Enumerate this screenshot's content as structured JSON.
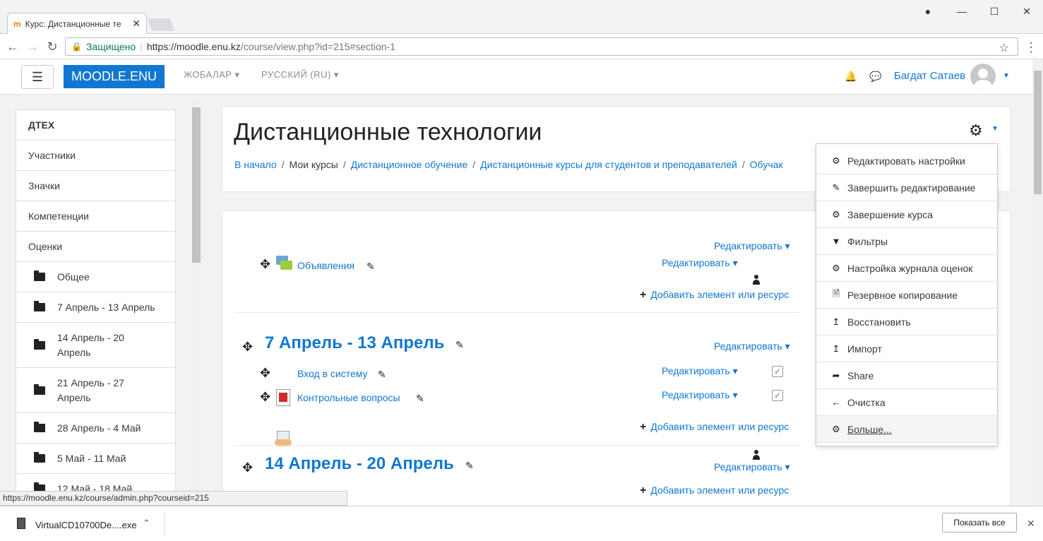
{
  "browser": {
    "tab_title": "Курс: Дистанционные те",
    "tab_close": "✕",
    "window_controls": [
      "—",
      "☐",
      "✕"
    ],
    "secure_label": "Защищено",
    "url_host": "https://moodle.enu.kz",
    "url_path": "/course/view.php?id=215#section-1",
    "status_url": "https://moodle.enu.kz/course/admin.php?courseid=215"
  },
  "navbar": {
    "brand": "MOODLE.ENU",
    "links": [
      "ЖОБАЛАР",
      "РУССКИЙ (RU)"
    ],
    "user_name": "Багдат Сатаев"
  },
  "sidebar": {
    "items": [
      {
        "label": "ДТЕХ"
      },
      {
        "label": "Участники"
      },
      {
        "label": "Значки"
      },
      {
        "label": "Компетенции"
      },
      {
        "label": "Оценки"
      },
      {
        "label": "Общее"
      },
      {
        "label": "7 Апрель - 13 Апрель"
      },
      {
        "label": "14 Апрель - 20 Апрель"
      },
      {
        "label": "21 Апрель - 27 Апрель"
      },
      {
        "label": "28 Апрель - 4 Май"
      },
      {
        "label": "5 Май - 11 Май"
      },
      {
        "label": "12 Май - 18 Май"
      }
    ]
  },
  "header": {
    "title": "Дистанционные технологии",
    "breadcrumb": [
      "В начало",
      "Мои курсы",
      "Дистанционное обучение",
      "Дистанционные курсы для студентов и преподавателей",
      "Обучак"
    ]
  },
  "course": {
    "edit_label": "Редактировать",
    "add_label": "Добавить элемент или ресурс",
    "general": {
      "activities": [
        "Объявления"
      ]
    },
    "sections": [
      {
        "title": "7 Апрель - 13 Апрель",
        "activities": [
          "Вход в систему",
          "Контрольные вопросы"
        ]
      },
      {
        "title": "14 Апрель - 20 Апрель",
        "activities": []
      }
    ]
  },
  "admin_menu": {
    "items": [
      {
        "label": "Редактировать настройки",
        "icon": "gear-icon"
      },
      {
        "label": "Завершить редактирование",
        "icon": "pencil-icon"
      },
      {
        "label": "Завершение курса",
        "icon": "gear-icon"
      },
      {
        "label": "Фильтры",
        "icon": "filter-icon"
      },
      {
        "label": "Настройка журнала оценок",
        "icon": "gear-icon"
      },
      {
        "label": "Резервное копирование",
        "icon": "backup-file-icon"
      },
      {
        "label": "Восстановить",
        "icon": "upload-arrow-icon"
      },
      {
        "label": "Импорт",
        "icon": "upload-arrow-icon"
      },
      {
        "label": "Share",
        "icon": "share-icon"
      },
      {
        "label": "Очистка",
        "icon": "arrow-left-icon"
      },
      {
        "label": "Больше...",
        "icon": "gear-icon"
      }
    ]
  },
  "download_bar": {
    "file_name": "VirtualCD10700De....exe",
    "show_all": "Показать все"
  },
  "colors": {
    "brand": "#1177d1",
    "link": "#1177d1"
  }
}
